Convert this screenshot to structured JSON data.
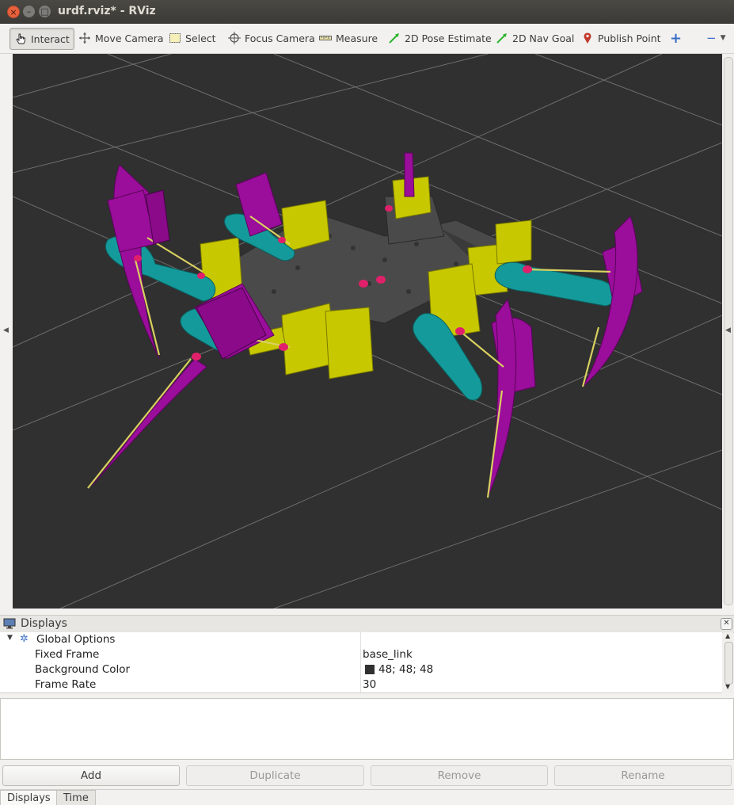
{
  "window": {
    "title": "urdf.rviz* - RViz"
  },
  "toolbar": {
    "tools": [
      {
        "label": "Interact",
        "icon": "hand-pointer-icon"
      },
      {
        "label": "Move Camera",
        "icon": "move-camera-icon"
      },
      {
        "label": "Select",
        "icon": "select-box-icon"
      },
      {
        "label": "Focus Camera",
        "icon": "focus-crosshair-icon"
      },
      {
        "label": "Measure",
        "icon": "ruler-icon"
      },
      {
        "label": "2D Pose Estimate",
        "icon": "green-arrow-icon"
      },
      {
        "label": "2D Nav Goal",
        "icon": "green-arrow-icon"
      },
      {
        "label": "Publish Point",
        "icon": "map-pin-icon"
      }
    ],
    "add_tool": "+",
    "remove_tool": "−"
  },
  "displays": {
    "title": "Displays",
    "global_options": "Global Options",
    "properties": [
      {
        "name": "Fixed Frame",
        "value": "base_link"
      },
      {
        "name": "Background Color",
        "value": "48; 48; 48",
        "swatch": "#303030"
      },
      {
        "name": "Frame Rate",
        "value": "30"
      }
    ],
    "buttons": {
      "add": "Add",
      "duplicate": "Duplicate",
      "remove": "Remove",
      "rename": "Rename"
    },
    "tabs": [
      "Displays",
      "Time"
    ]
  },
  "colors": {
    "background": "#303030",
    "grid": "#a0a0a0",
    "servo": "#c8c800",
    "horn": "#149a9a",
    "leg": "#9b0d9b",
    "frame": "#4a4a4a",
    "axis": "#d8d060",
    "joint": "#e0206a"
  }
}
